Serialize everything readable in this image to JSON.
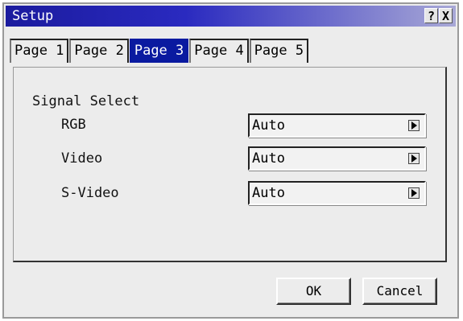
{
  "window": {
    "title": "Setup"
  },
  "titlebar_buttons": {
    "help": "?",
    "close": "X"
  },
  "tabs": [
    {
      "label": "Page 1",
      "active": false
    },
    {
      "label": "Page 2",
      "active": false
    },
    {
      "label": "Page 3",
      "active": true
    },
    {
      "label": "Page 4",
      "active": false
    },
    {
      "label": "Page 5",
      "active": false
    }
  ],
  "section": {
    "label": "Signal Select"
  },
  "rows": [
    {
      "label": "RGB",
      "value": "Auto",
      "icon": "right-arrow-icon"
    },
    {
      "label": "Video",
      "value": "Auto",
      "icon": "right-arrow-icon"
    },
    {
      "label": "S-Video",
      "value": "Auto",
      "icon": "right-arrow-icon"
    }
  ],
  "buttons": {
    "ok": "OK",
    "cancel": "Cancel"
  },
  "colors": {
    "titlebar": "#1b1b9e",
    "active_tab": "#0a1aa0",
    "background": "#ececec"
  }
}
